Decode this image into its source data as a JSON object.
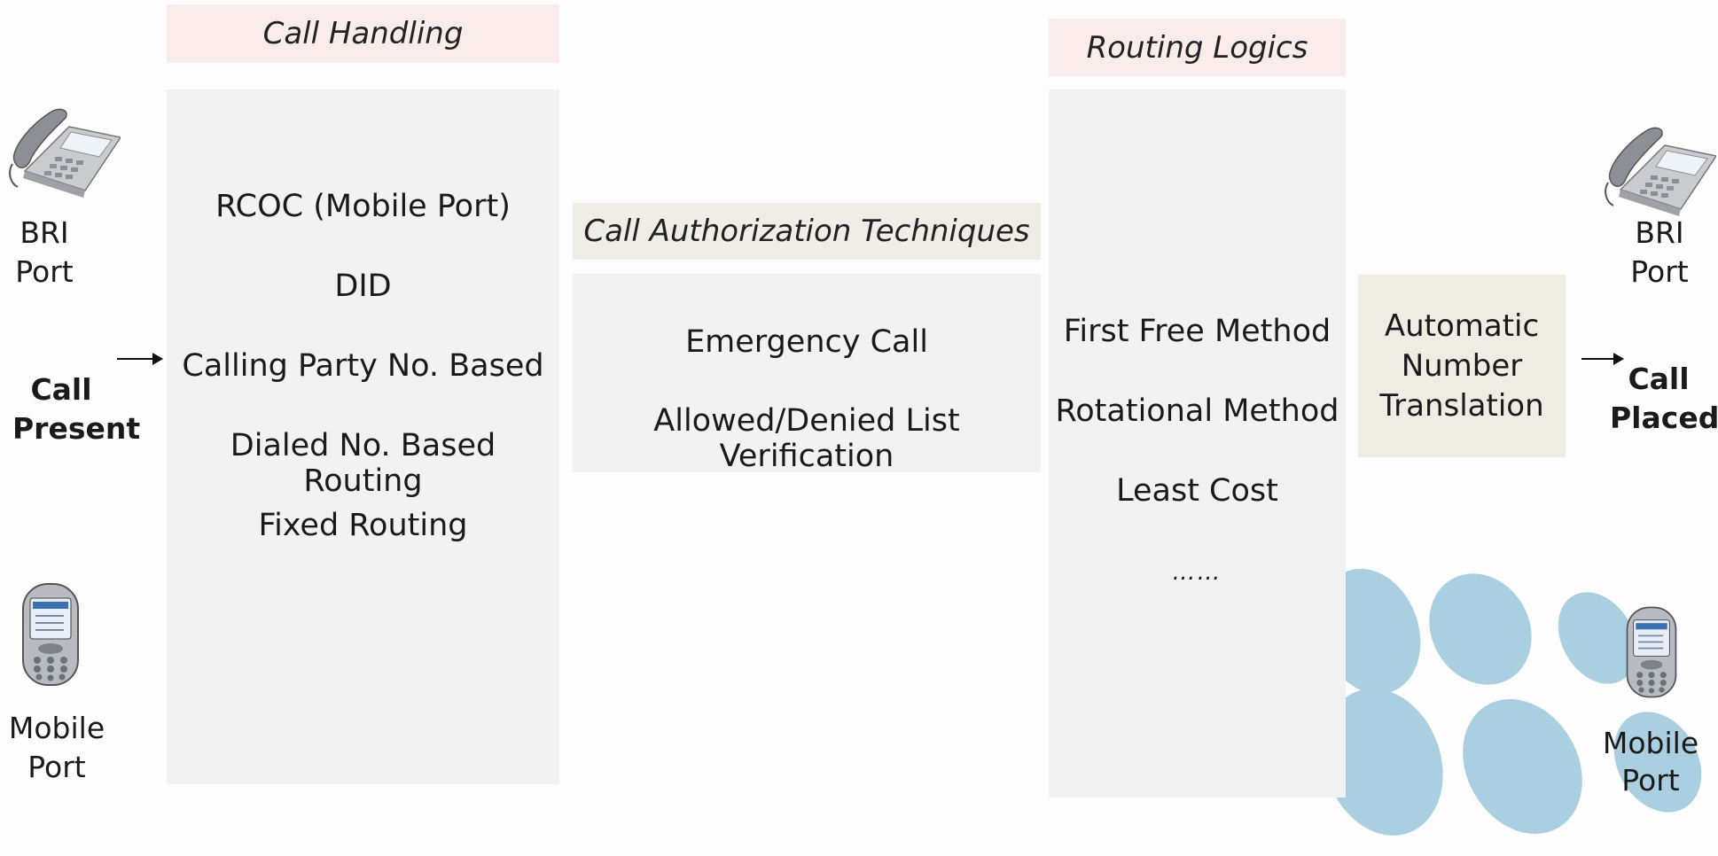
{
  "call_handling": {
    "header": "Call Handling",
    "items": [
      "RCOC (Mobile Port)",
      "DID",
      "Calling Party No. Based",
      "Dialed No. Based Routing",
      "Fixed Routing"
    ]
  },
  "call_authorization": {
    "header": "Call Authorization Techniques",
    "items": [
      "Emergency Call",
      "Allowed/Denied List Verification"
    ]
  },
  "routing_logics": {
    "header": "Routing Logics",
    "items": [
      "First Free Method",
      "Rotational Method",
      "Least Cost",
      "……"
    ]
  },
  "ant": {
    "lines": [
      "Automatic",
      "Number",
      "Translation"
    ]
  },
  "left": {
    "bri_port": [
      "BRI",
      "Port"
    ],
    "call_present": [
      "Call",
      "Present"
    ],
    "mobile_port": [
      "Mobile",
      "Port"
    ]
  },
  "right": {
    "bri_port": [
      "BRI",
      "Port"
    ],
    "call_placed": [
      "Call",
      "Placed"
    ],
    "mobile_port": [
      "Mobile",
      "Port"
    ]
  },
  "colors": {
    "header_pink": "#fbecec",
    "header_beige": "#efede6",
    "panel_gray": "#f2f2f2",
    "blob_blue": "#a9cfe0"
  },
  "icons": [
    "desk-phone-icon",
    "mobile-phone-icon"
  ]
}
